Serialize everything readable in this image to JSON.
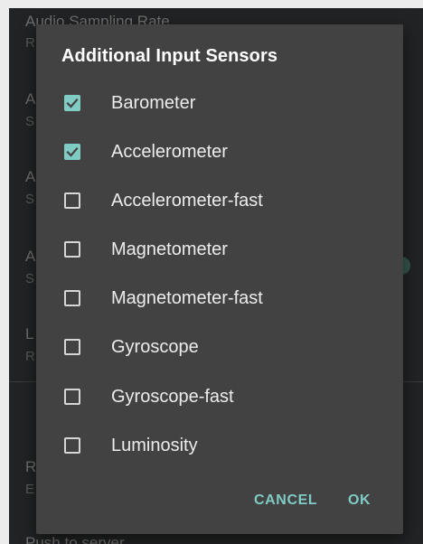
{
  "background": {
    "items": [
      {
        "title": "Audio Sampling Rate",
        "subtitle": "R"
      },
      {
        "title": "A",
        "subtitle": "S"
      },
      {
        "title": "A",
        "subtitle": "S"
      },
      {
        "title": "A",
        "subtitle": "S"
      },
      {
        "title": "L",
        "subtitle": "R"
      },
      {
        "title": "R",
        "subtitle": "E"
      },
      {
        "title": "Push to server",
        "subtitle": ""
      }
    ]
  },
  "dialog": {
    "title": "Additional Input Sensors",
    "options": [
      {
        "label": "Barometer",
        "checked": true
      },
      {
        "label": "Accelerometer",
        "checked": true
      },
      {
        "label": "Accelerometer-fast",
        "checked": false
      },
      {
        "label": "Magnetometer",
        "checked": false
      },
      {
        "label": "Magnetometer-fast",
        "checked": false
      },
      {
        "label": "Gyroscope",
        "checked": false
      },
      {
        "label": "Gyroscope-fast",
        "checked": false
      },
      {
        "label": "Luminosity",
        "checked": false
      }
    ],
    "cancel_label": "CANCEL",
    "ok_label": "OK"
  },
  "colors": {
    "accent": "#80cbc4",
    "dialog_bg": "#424242",
    "screen_bg": "#222324"
  }
}
